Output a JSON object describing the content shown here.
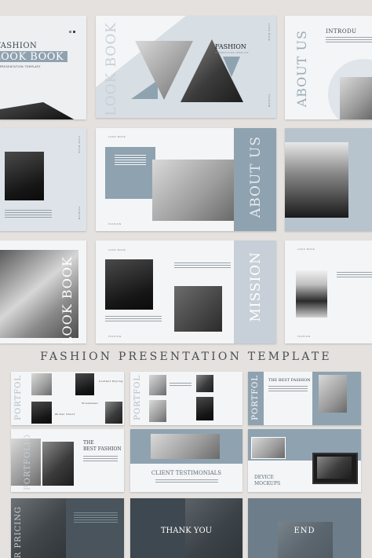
{
  "main_title": "FASHION PRESENTATION TEMPLATE",
  "slides": {
    "cover": {
      "title_top": "FASHION",
      "title_main": "LOOK BOOK",
      "subtitle": "PRESENTATION TEMPLATE"
    },
    "lookbook": {
      "vertical": "LOOK BOOK",
      "fashion": "FASHION",
      "subtitle": "PRESENTATION TEMPLATE",
      "side1": "LOOK BOOK",
      "side2": "FASHION"
    },
    "about1": {
      "vertical": "ABOUT US",
      "title": "INTRODU"
    },
    "text_slide": {
      "caption": "LOOK BOOK",
      "side": "FASHION"
    },
    "about2": {
      "vertical": "ABOUT US",
      "tag": "LOOK BOOK",
      "footer": "FASHION"
    },
    "dark_portrait": {},
    "lookbook2": {
      "vertical": "LOOK BOOK"
    },
    "mission": {
      "vertical": "MISSION",
      "tag": "LOOK BOOK",
      "footer": "FASHION"
    },
    "last_right": {
      "tag": "LOOK BOOK",
      "footer": "FASHION"
    },
    "portfolio1": {
      "vertical": "PORTFOL",
      "label1": "Content Styling",
      "label2": "Streetwear",
      "label3": "Winter Shoot"
    },
    "portfolio2": {
      "vertical": "PORTFOL"
    },
    "portfolio3": {
      "vertical": "PORTFOL",
      "title": "THE BEST FASHION"
    },
    "best_fashion": {
      "vertical": "PORTFOLIO",
      "title_line1": "THE",
      "title_line2": "BEST FASHION"
    },
    "testimonials": {
      "title": "CLIENT TESTIMONIALS"
    },
    "device": {
      "title_line1": "DEVICE",
      "title_line2": "MOCKUPS"
    },
    "pricing": {
      "vertical": "OUR PRICING"
    },
    "thank_you": {
      "title": "THANK YOU"
    },
    "end": {
      "title": "END"
    }
  },
  "colors": {
    "background": "#e4e1df",
    "accent_blue": "#8fa2b0",
    "light_blue": "#c7d0d8",
    "dark_slate": "#49545c"
  }
}
